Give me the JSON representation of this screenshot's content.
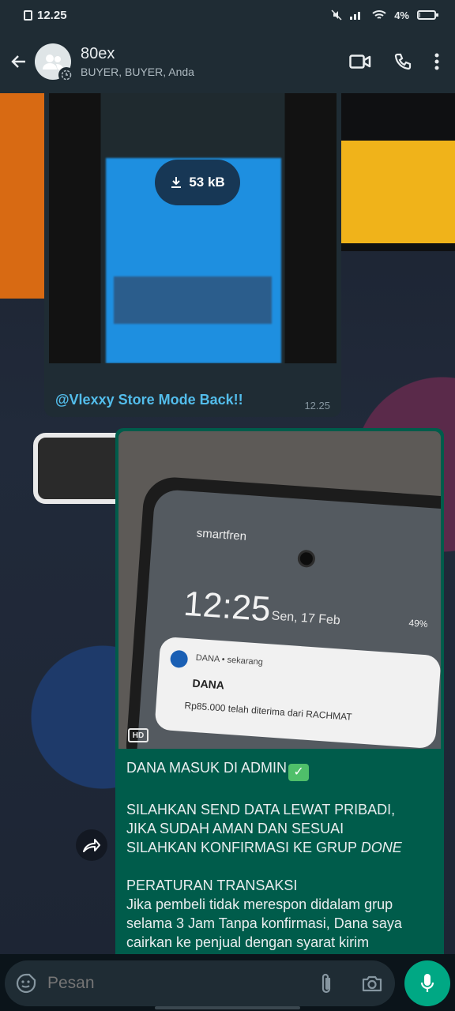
{
  "status_bar": {
    "time": "12.25",
    "battery": "4%",
    "battery_level": 0.04
  },
  "header": {
    "title": "80ex",
    "subtitle": "BUYER, BUYER, Anda"
  },
  "incoming": {
    "download_size": "53 kB",
    "caption": "@Vlexxy Store Mode Back!!",
    "time": "12.25"
  },
  "photo": {
    "carrier": "smartfren",
    "clock": "12:25",
    "date": "Sen, 17 Feb",
    "status": "49%",
    "notif_app": "DANA • sekarang",
    "notif_title": "DANA",
    "notif_body": "Rp85.000 telah diterima dari RACHMAT",
    "hd_label": "HD"
  },
  "message": {
    "line1": "DANA MASUK DI ADMIN",
    "para2_l1": "SILAHKAN SEND DATA LEWAT PRIBADI,",
    "para2_l2": "JIKA SUDAH AMAN DAN SESUAI",
    "para2_l3": "SILAHKAN KONFIRMASI KE GRUP ",
    "para2_done": "DONE",
    "rules_title": "PERATURAN TRANSAKSI",
    "rules_body": "Jika pembeli tidak merespon didalam grup selama 3 Jam Tanpa konfirmasi, Dana saya cairkan ke penjual dengan syarat kirim"
  },
  "input": {
    "placeholder": "Pesan"
  },
  "colors": {
    "accent": "#00a884",
    "bubble_out": "#005c4b",
    "link": "#53bdeb"
  }
}
